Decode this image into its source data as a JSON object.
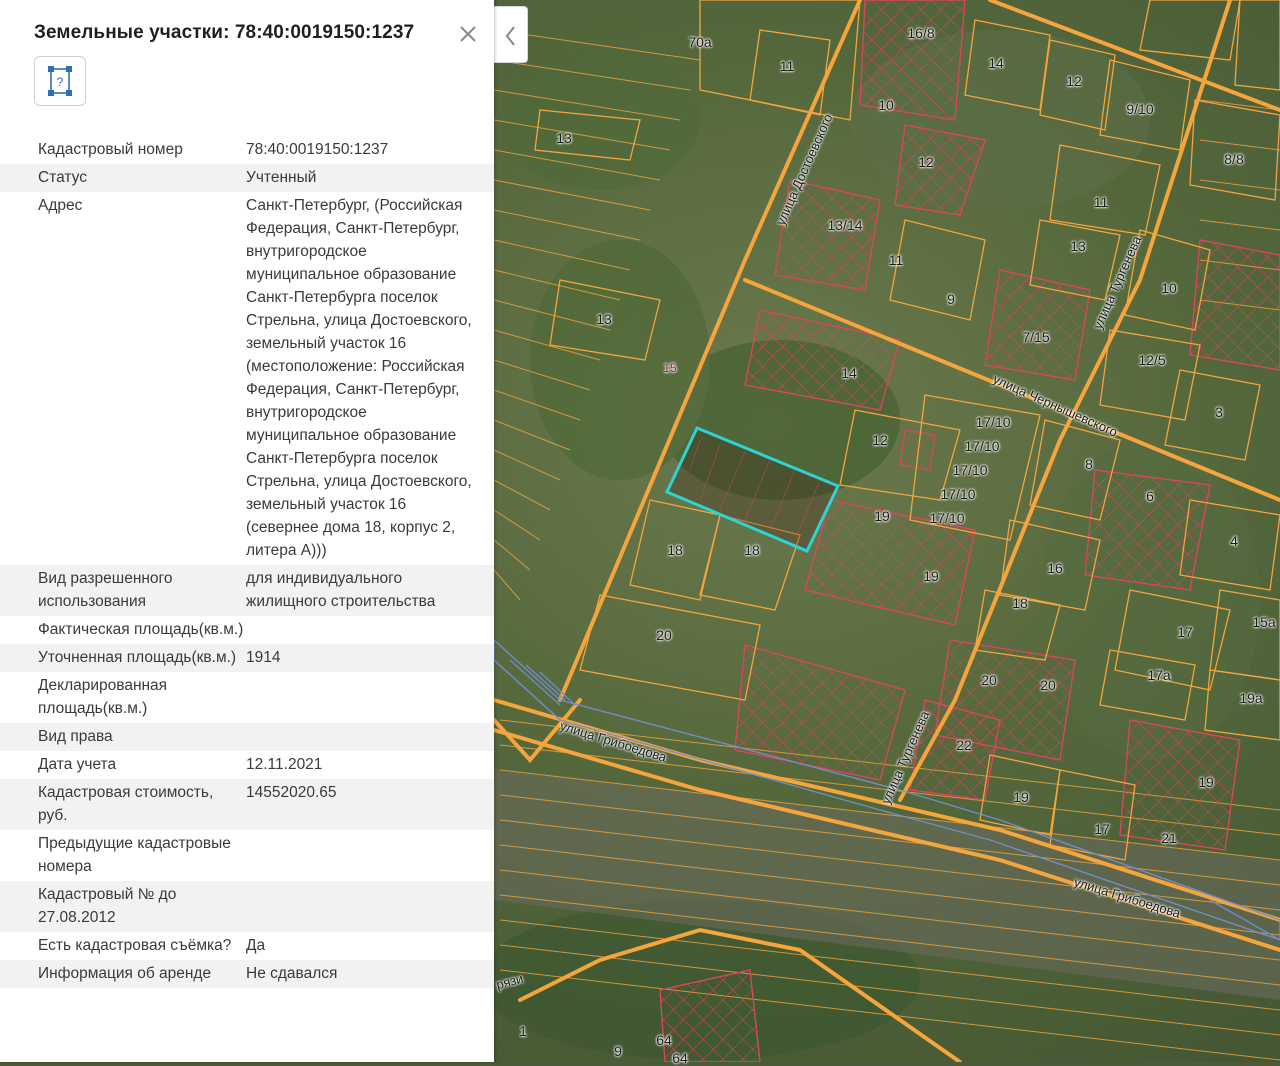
{
  "panel": {
    "title": "Земельные участки: 78:40:0019150:1237",
    "tool_glyph": "?",
    "rows": [
      {
        "key": "Кадастровый номер",
        "value": "78:40:0019150:1237"
      },
      {
        "key": "Статус",
        "value": "Учтенный"
      },
      {
        "key": "Адрес",
        "value": "Санкт-Петербург, (Российская Федерация, Санкт-Петербург, внутригородское муниципальное образование Санкт-Петербурга поселок Стрельна, улица Достоевского, земельный участок 16 (местоположение: Российская Федерация, Санкт-Петербург, внутригородское муниципальное образование Санкт-Петербурга поселок Стрельна, улица Достоевского, земельный участок 16 (севернее дома 18, корпус 2, литера А)))"
      },
      {
        "key": "Вид разрешенного использования",
        "value": "для индивидуального жилищного строительства"
      },
      {
        "key": "Фактическая площадь(кв.м.)",
        "value": ""
      },
      {
        "key": "Уточненная площадь(кв.м.)",
        "value": "1914"
      },
      {
        "key": "Декларированная площадь(кв.м.)",
        "value": ""
      },
      {
        "key": "Вид права",
        "value": ""
      },
      {
        "key": "Дата учета",
        "value": "12.11.2021"
      },
      {
        "key": "Кадастровая стоимость, руб.",
        "value": "14552020.65"
      },
      {
        "key": "Предыдущие кадастровые номера",
        "value": ""
      },
      {
        "key": "Кадастровый № до 27.08.2012",
        "value": ""
      },
      {
        "key": "Есть кадастровая съёмка?",
        "value": "Да"
      },
      {
        "key": "Информация об аренде",
        "value": "Не сдавался"
      }
    ]
  },
  "map": {
    "house_numbers": [
      "70а",
      "11",
      "16/8",
      "14",
      "12",
      "9/10",
      "10",
      "12",
      "13",
      "8/8",
      "11",
      "13/14",
      "11",
      "13",
      "10",
      "9",
      "7/15",
      "12/5",
      "14",
      "3",
      "12",
      "17/10",
      "17/10",
      "17/10",
      "17/10",
      "17/10",
      "8",
      "6",
      "19",
      "4",
      "18",
      "18",
      "16",
      "19",
      "18",
      "15а",
      "17",
      "20",
      "20",
      "20",
      "17а",
      "19а",
      "22",
      "19",
      "17",
      "21",
      "19",
      "13",
      "13",
      "15",
      "1",
      "9",
      "64",
      "64"
    ],
    "streets": [
      "улица Достоевского",
      "улица Тургенева",
      "улица Чернышевского",
      "улица Грибоедова",
      "улица Тургенева",
      "улица Грибоедова",
      "рязи"
    ]
  },
  "colors": {
    "boundary": "#f5a53c",
    "parcel_red": "#d9475a",
    "selected": "#2fd3d6",
    "railway": "#6f8fd0"
  }
}
